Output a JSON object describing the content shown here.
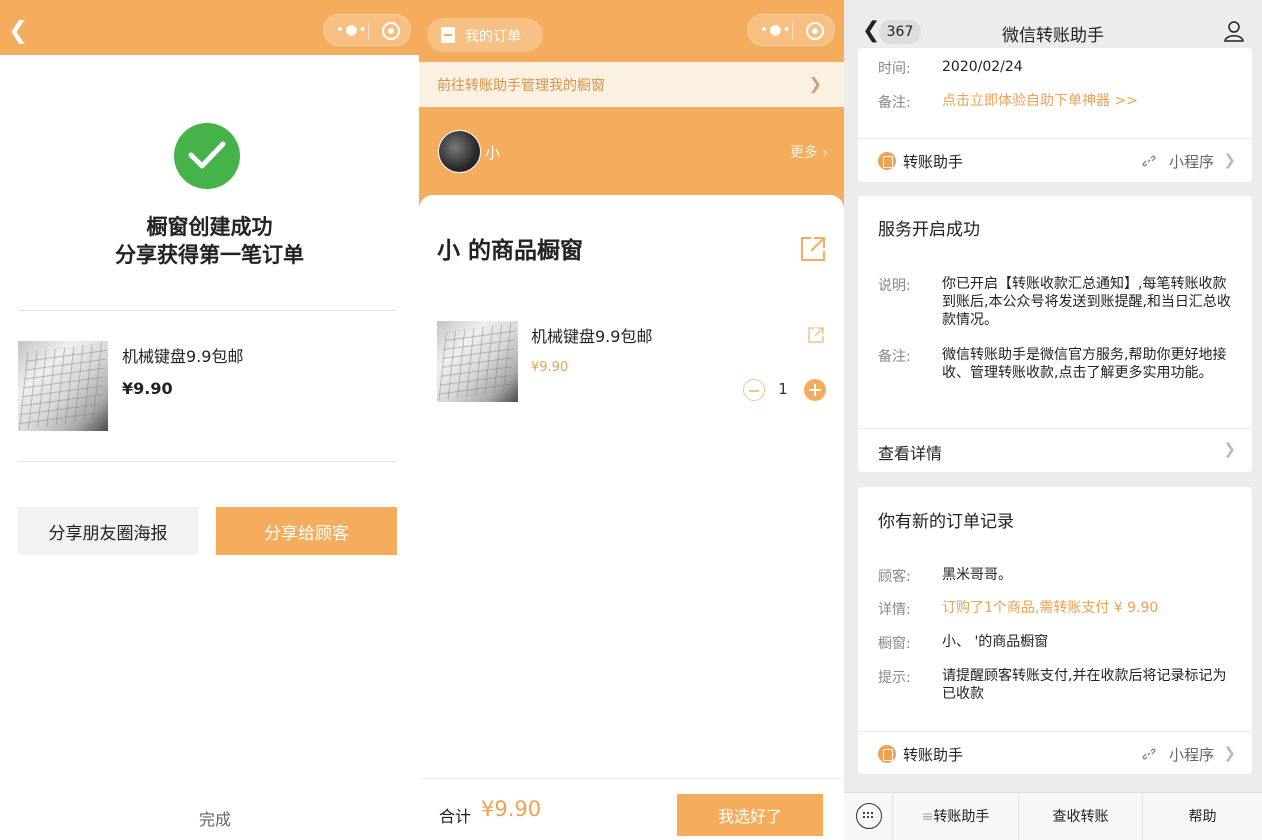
{
  "screen1": {
    "success_line1": "橱窗创建成功",
    "success_line2": "分享获得第一笔订单",
    "product_name": "机械键盘9.9包邮",
    "product_price": "¥9.90",
    "btn_share_poster": "分享朋友圈海报",
    "btn_share_customer": "分享给顾客",
    "done": "完成"
  },
  "screen2": {
    "my_orders": "我的订单",
    "notice": "前往转账助手管理我的橱窗",
    "seller_name": "小",
    "more": "更多",
    "shop_title": "小  的商品橱窗",
    "product_name": "机械键盘9.9包邮",
    "product_price": "¥9.90",
    "quantity": "1",
    "total_label": "合计",
    "total_value": "¥9.90",
    "confirm": "我选好了"
  },
  "screen3": {
    "back_count": "367",
    "title": "微信转账助手",
    "msg1": {
      "time_label": "时间:",
      "time_value": "2020/02/24",
      "note_label": "备注:",
      "note_value": "点击立即体验自助下单神器 >>",
      "footer_name": "转账助手",
      "footer_right": "小程序"
    },
    "msg2": {
      "title": "服务开启成功",
      "desc_label": "说明:",
      "desc_value": "你已开启【转账收款汇总通知】,每笔转账收款到账后,本公众号将发送到账提醒,和当日汇总收款情况。",
      "note_label": "备注:",
      "note_value": "微信转账助手是微信官方服务,帮助你更好地接收、管理转账收款,点击了解更多实用功能。",
      "detail": "查看详情"
    },
    "msg3": {
      "title": "你有新的订单记录",
      "customer_label": "顾客:",
      "customer_value": "黑米哥哥。",
      "detail_label": "详情:",
      "detail_value": "订购了1个商品,需转账支付 ¥ 9.90",
      "shop_label": "橱窗:",
      "shop_value": "小、 '的商品橱窗",
      "tip_label": "提示:",
      "tip_value": "请提醒顾客转账支付,并在收款后将记录标记为已收款",
      "footer_name": "转账助手",
      "footer_right": "小程序"
    },
    "menu": [
      "转账助手",
      "查收转账",
      "帮助"
    ]
  },
  "colors": {
    "accent": "#f5ad5d",
    "success": "#46b34a",
    "price": "#f0a152"
  }
}
